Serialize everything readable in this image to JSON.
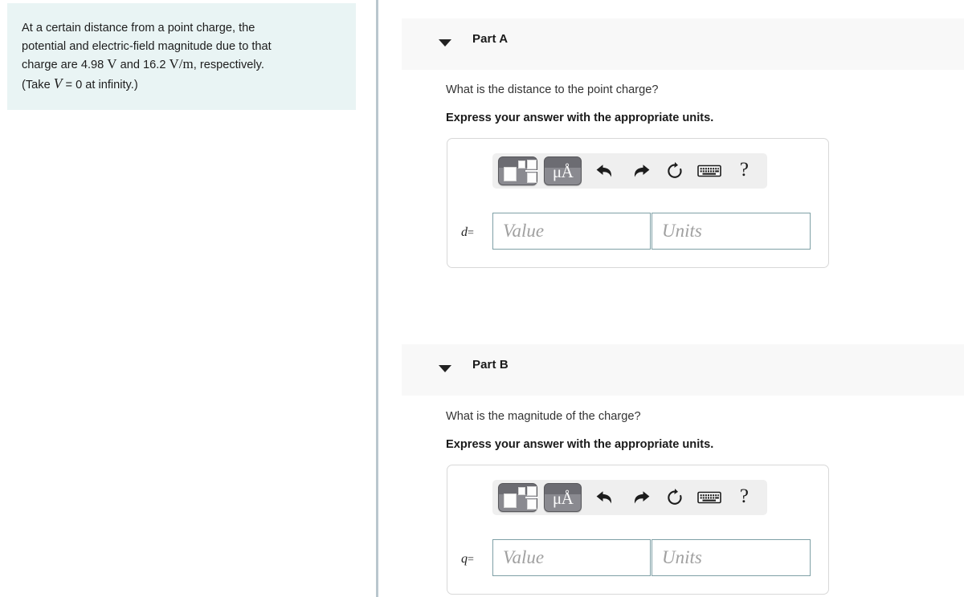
{
  "problem": {
    "line1": "At a certain distance from a point charge, the",
    "line2": "potential and electric-field magnitude due to that",
    "line3_a": "charge are 4.98",
    "line3_unit1": "V",
    "line3_b": "and 16.2",
    "line3_unit2_num": "V",
    "line3_unit2_slash": "/",
    "line3_unit2_den": "m",
    "line3_c": ", respectively.",
    "line4_a": "(Take",
    "line4_sym": "V",
    "line4_b": "= 0 at infinity.)"
  },
  "parts": [
    {
      "title": "Part A",
      "caret_icon": "caret-down-icon",
      "question": "What is the distance to the point charge?",
      "express": "Express your answer with the appropriate units.",
      "variable": "d",
      "equals": "=",
      "value_placeholder": "Value",
      "units_placeholder": "Units",
      "value_text": "",
      "units_text": "",
      "toolbar": {
        "template_button": "template-icon",
        "units_button_label": "μÅ",
        "undo_label": "undo-arrow-icon",
        "redo_label": "redo-arrow-icon",
        "reset_label": "reset-circular-arrow-icon",
        "keyboard_label": "keyboard-icon",
        "help_label": "?"
      }
    },
    {
      "title": "Part B",
      "caret_icon": "caret-down-icon",
      "question": "What is the magnitude of the charge?",
      "express": "Express your answer with the appropriate units.",
      "variable": "q",
      "equals": "=",
      "value_placeholder": "Value",
      "units_placeholder": "Units",
      "value_text": "",
      "units_text": "",
      "toolbar": {
        "template_button": "template-icon",
        "units_button_label": "μÅ",
        "undo_label": "undo-arrow-icon",
        "redo_label": "redo-arrow-icon",
        "reset_label": "reset-circular-arrow-icon",
        "keyboard_label": "keyboard-icon",
        "help_label": "?"
      }
    }
  ],
  "colors": {
    "problem_bg": "#e9f4f4",
    "header_bg": "#f8f8f8",
    "divider": "#b9c6ce",
    "input_border": "#7fa0a6",
    "toolbar_bg": "#efefef",
    "button_dark": "#6c6c72"
  }
}
